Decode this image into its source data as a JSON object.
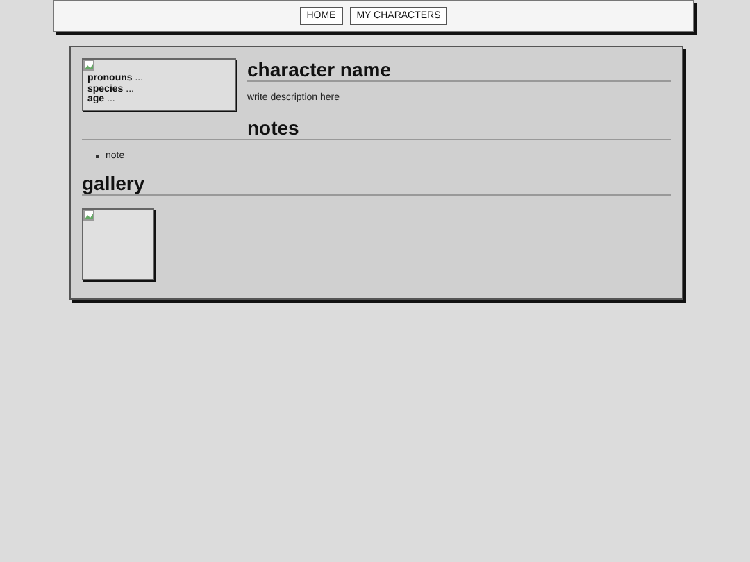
{
  "nav": {
    "links": [
      "HOME",
      "MY CHARACTERS"
    ]
  },
  "infobox": {
    "fields": [
      "**pronouns** ...",
      "**species** ...",
      "**age** ..."
    ]
  },
  "title": "character name",
  "description": "write description here",
  "notes": {
    "heading": "notes",
    "items": [
      "note"
    ]
  },
  "gallery": {
    "heading": "gallery"
  }
}
